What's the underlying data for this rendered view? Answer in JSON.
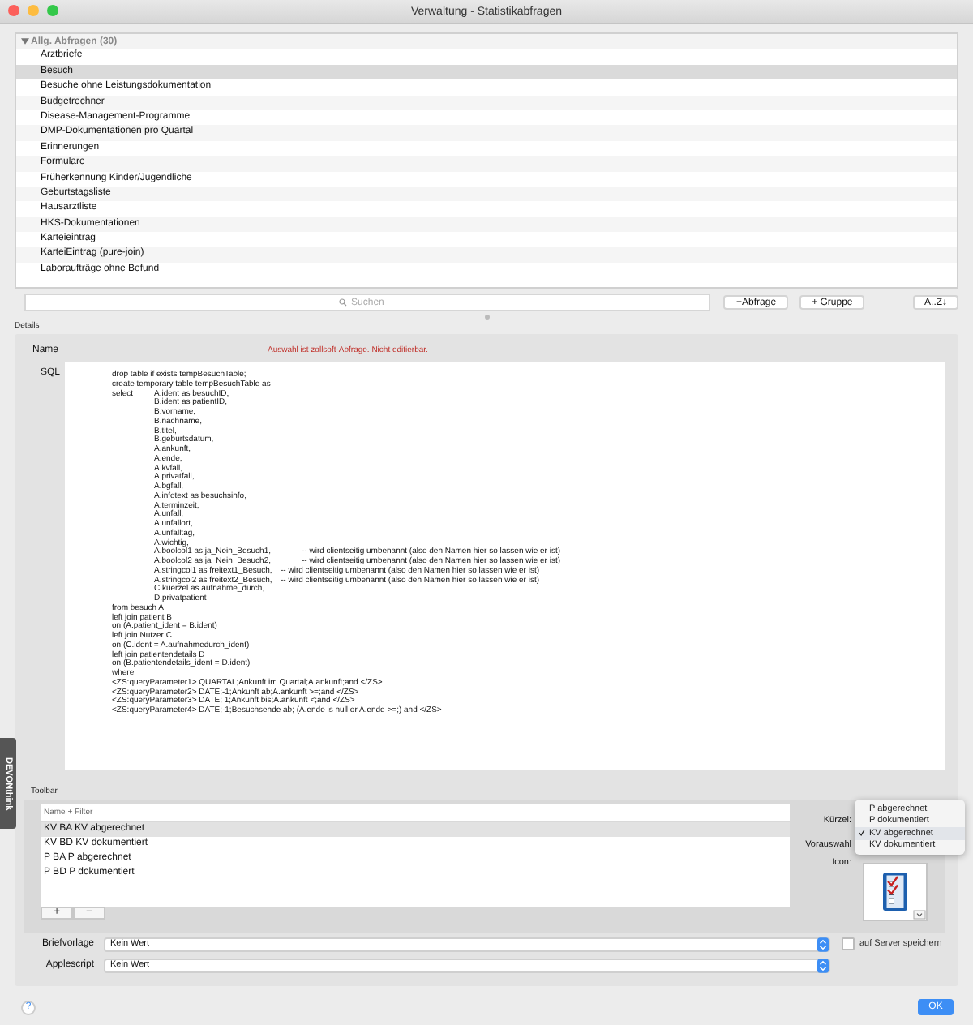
{
  "window": {
    "title": "Verwaltung - Statistikabfragen"
  },
  "query_list": {
    "group": {
      "label": "Allg. Abfragen (30)",
      "expanded": true
    },
    "items": [
      {
        "label": "Arztbriefe",
        "selected": false
      },
      {
        "label": "Besuch",
        "selected": true
      },
      {
        "label": "Besuche ohne Leistungsdokumentation",
        "selected": false
      },
      {
        "label": "Budgetrechner",
        "selected": false
      },
      {
        "label": "Disease-Management-Programme",
        "selected": false
      },
      {
        "label": "DMP-Dokumentationen pro Quartal",
        "selected": false
      },
      {
        "label": "Erinnerungen",
        "selected": false
      },
      {
        "label": "Formulare",
        "selected": false
      },
      {
        "label": "Früherkennung Kinder/Jugendliche",
        "selected": false
      },
      {
        "label": "Geburtstagsliste",
        "selected": false
      },
      {
        "label": "Hausarztliste",
        "selected": false
      },
      {
        "label": "HKS-Dokumentationen",
        "selected": false
      },
      {
        "label": "Karteieintrag",
        "selected": false
      },
      {
        "label": "KarteiEintrag (pure-join)",
        "selected": false
      },
      {
        "label": "Laboraufträge ohne Befund",
        "selected": false
      }
    ]
  },
  "search": {
    "placeholder": "Suchen"
  },
  "buttons": [
    "+Abfrage",
    "+ Gruppe",
    "A..Z↓"
  ],
  "details": {
    "title": "Details",
    "name_label": "Name",
    "notice": "Auswahl ist zollsoft-Abfrage. Nicht editierbar.",
    "sql_label": "SQL",
    "sql_lines": [
      "\t\tdrop table if exists tempBesuchTable;",
      "\t\tcreate temporary table tempBesuchTable as",
      "\t\tselect\tA.ident as besuchID,",
      "\t\t\t\tB.ident as patientID,",
      "\t\t\t\tB.vorname,",
      "\t\t\t\tB.nachname,",
      "\t\t\t\tB.titel,",
      "\t\t\t\tB.geburtsdatum,",
      "\t\t\t\tA.ankunft,",
      "\t\t\t\tA.ende,",
      "\t\t\t\tA.kvfall,",
      "\t\t\t\tA.privatfall,",
      "\t\t\t\tA.bgfall,",
      "\t\t\t\tA.infotext as besuchsinfo,",
      "\t\t\t\tA.terminzeit,",
      "\t\t\t\tA.unfall,",
      "\t\t\t\tA.unfallort,",
      "\t\t\t\tA.unfalltag,",
      "\t\t\t\tA.wichtig,",
      "\t\t\t\tA.boolcol1 as ja_Nein_Besuch1,\t\t-- wird clientseitig umbenannt (also den Namen hier so lassen wie er ist)",
      "\t\t\t\tA.boolcol2 as ja_Nein_Besuch2,\t\t-- wird clientseitig umbenannt (also den Namen hier so lassen wie er ist)",
      "\t\t\t\tA.stringcol1 as freitext1_Besuch,\t-- wird clientseitig umbenannt (also den Namen hier so lassen wie er ist)",
      "\t\t\t\tA.stringcol2 as freitext2_Besuch,\t-- wird clientseitig umbenannt (also den Namen hier so lassen wie er ist)",
      "\t\t\t\tC.kuerzel as aufnahme_durch,",
      "\t\t\t\tD.privatpatient",
      "\t\tfrom besuch A",
      "\t\tleft join patient B",
      "\t\ton (A.patient_ident = B.ident)",
      "\t\tleft join Nutzer C",
      "\t\ton (C.ident = A.aufnahmedurch_ident)",
      "\t\tleft join patientendetails D",
      "\t\ton (B.patientendetails_ident = D.ident)",
      "\t\twhere",
      "\t\t<ZS:queryParameter1> QUARTAL;Ankunft im Quartal;A.ankunft;and </ZS>",
      "\t\t<ZS:queryParameter2> DATE;-1;Ankunft ab;A.ankunft >=;and </ZS>",
      "\t\t<ZS:queryParameter3> DATE; 1;Ankunft bis;A.ankunft <;and </ZS>",
      "\t\t<ZS:queryParameter4> DATE;-1;Besuchsende ab; (A.ende is null or A.ende >=;) and </ZS>"
    ]
  },
  "toolbar": {
    "title": "Toolbar",
    "filter": {
      "placeholder": "Name + Filter"
    },
    "items": [
      {
        "label": "KV BA KV abgerechnet",
        "selected": true
      },
      {
        "label": "KV BD KV dokumentiert",
        "selected": false
      },
      {
        "label": "P BA P abgerechnet",
        "selected": false
      },
      {
        "label": "P BD P dokumentiert",
        "selected": false
      }
    ],
    "add": "+",
    "remove": "−",
    "labels": [
      "Kürzel:",
      "Vorauswahl",
      "Icon:"
    ],
    "menu": [
      {
        "label": "P abgerechnet",
        "selected": false
      },
      {
        "label": "P dokumentiert",
        "selected": false
      },
      {
        "label": "KV abgerechnet",
        "selected": true
      },
      {
        "label": "KV dokumentiert",
        "selected": false
      }
    ]
  },
  "briefvorlage": {
    "label": "Briefvorlage",
    "value": "Kein Wert"
  },
  "applescript": {
    "label": "Applescript",
    "value": "Kein Wert"
  },
  "server_checkbox": {
    "label": "auf Server speichern",
    "checked": false
  },
  "help": "?",
  "ok": "OK",
  "side_tab": "DEVONthink"
}
